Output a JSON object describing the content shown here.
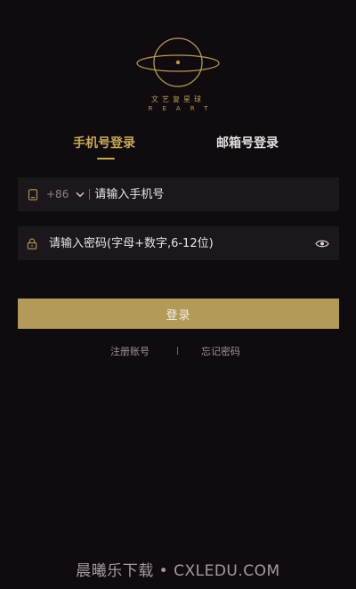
{
  "logo": {
    "cn": "文艺复星球",
    "en": "REART",
    "color": "#b59a55"
  },
  "tabs": {
    "phone_label": "手机号登录",
    "email_label": "邮箱号登录",
    "active": "phone"
  },
  "phone_field": {
    "icon": "phone-icon",
    "country_code": "+86",
    "placeholder": "请输入手机号",
    "value": ""
  },
  "password_field": {
    "icon": "lock-icon",
    "placeholder": "请输入密码(字母+数字,6-12位)",
    "value": "",
    "toggle_icon": "eye-icon"
  },
  "login_button": {
    "label": "登录",
    "color": "#b49a58"
  },
  "links": {
    "register": "注册账号",
    "forgot": "忘记密码"
  },
  "watermark": {
    "text": "晨曦乐下载 • CXLEDU.COM"
  },
  "colors": {
    "background": "#100b0f",
    "accent": "#c8a95c",
    "field_bg": "#1c171c"
  }
}
